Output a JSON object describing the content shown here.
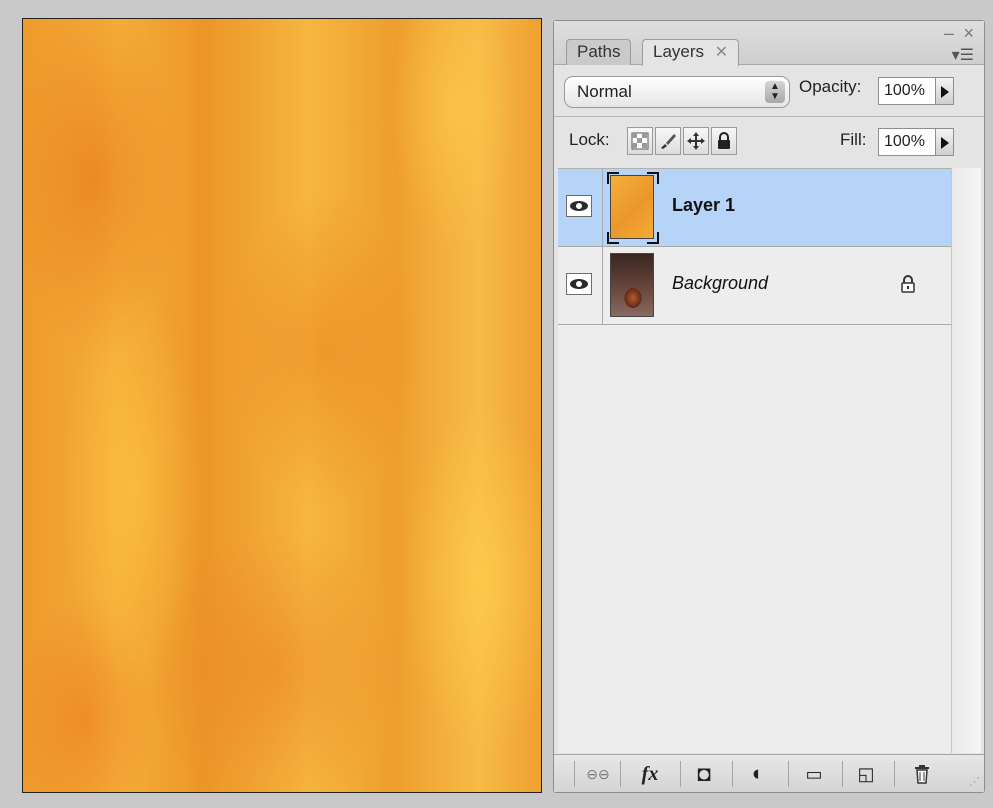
{
  "canvas": {
    "name": "document-canvas"
  },
  "panel": {
    "tabs": [
      {
        "label": "Paths"
      },
      {
        "label": "Layers",
        "close": "✕"
      }
    ],
    "window_controls": {
      "minimize": "–",
      "close": "×"
    },
    "menu_icon": "▾☰",
    "blend_mode": "Normal",
    "opacity_label": "Opacity:",
    "opacity_value": "100%",
    "lock_label": "Lock:",
    "fill_label": "Fill:",
    "fill_value": "100%",
    "layers": [
      {
        "name": "Layer 1",
        "visible": true,
        "selected": true
      },
      {
        "name": "Background",
        "visible": true,
        "selected": false,
        "locked": true
      }
    ],
    "bottom_toolbar": {
      "link": "⊖⊖",
      "fx": "fx",
      "mask": "◘",
      "adjustment": "◐",
      "group": "▭",
      "new_layer": "◱",
      "delete": "🗑"
    }
  }
}
